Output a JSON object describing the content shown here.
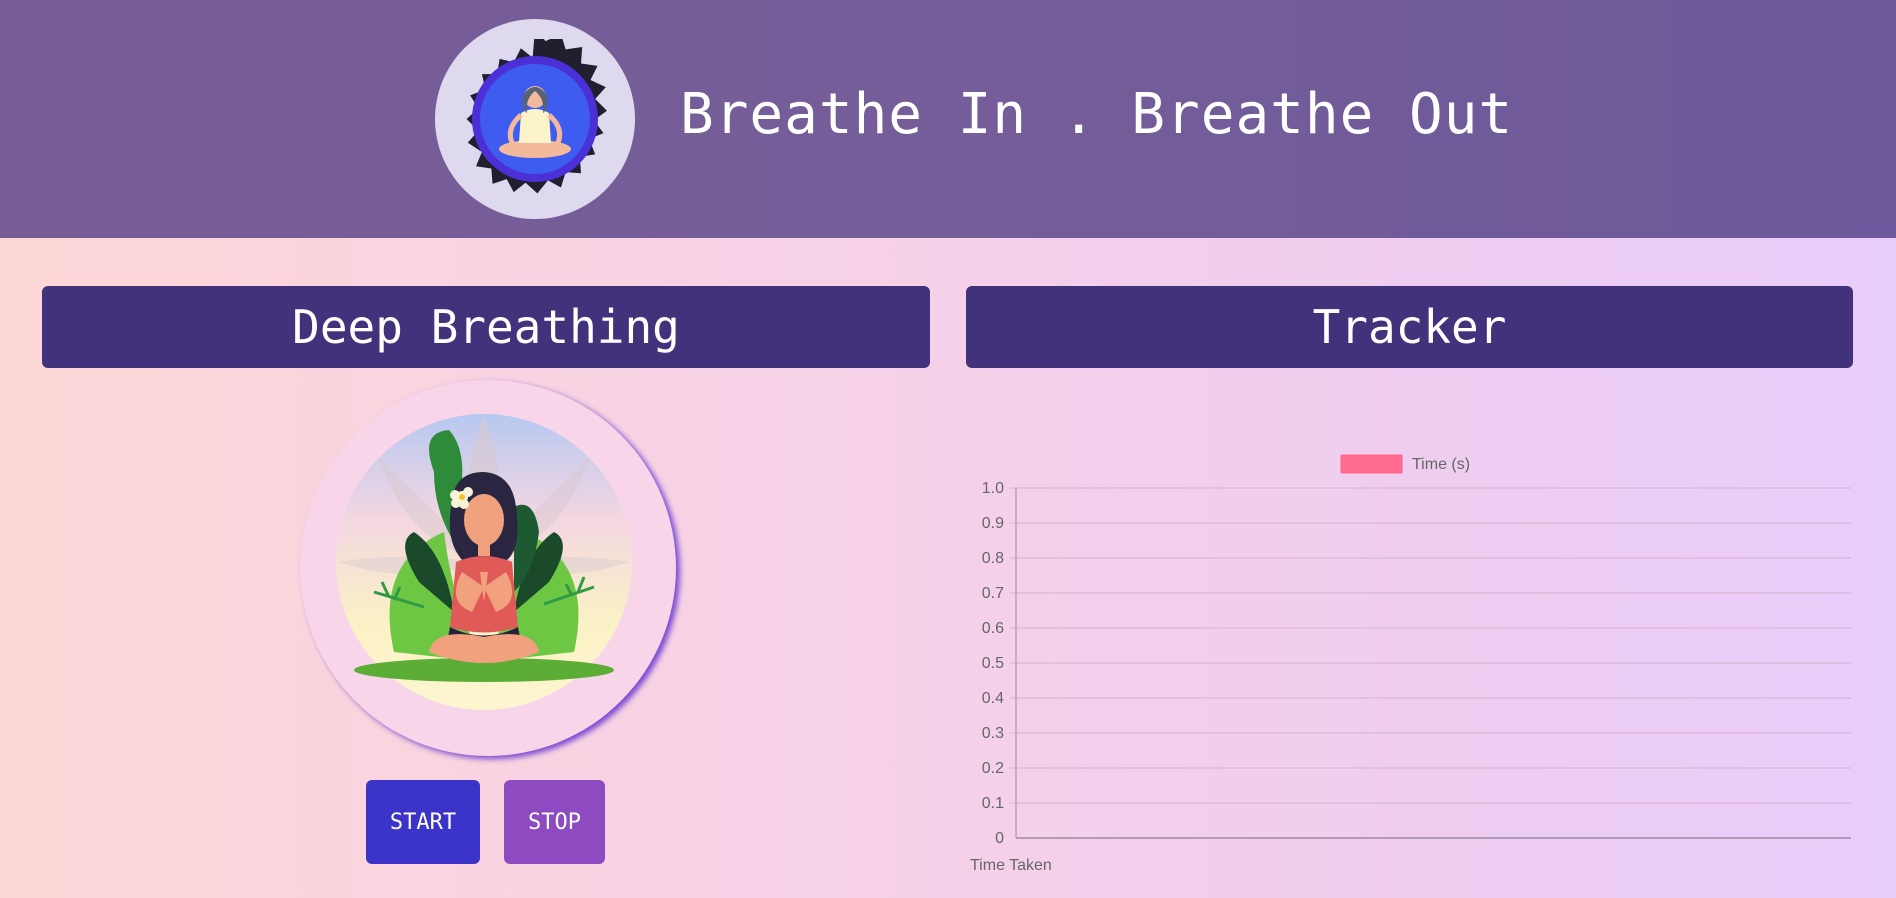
{
  "header": {
    "title": "Breathe In . Breathe Out",
    "logo_icon": "meditation-logo-icon"
  },
  "left_panel": {
    "title": "Deep Breathing",
    "illustration_icon": "meditating-woman-illustration",
    "start_label": "START",
    "stop_label": "STOP"
  },
  "right_panel": {
    "title": "Tracker"
  },
  "colors": {
    "header_bg": "#745d98",
    "panel_title_bg": "#42327b",
    "start_button": "#3c34c8",
    "stop_button": "#8e4bc1",
    "series_fill": "#ff6384"
  },
  "chart_data": {
    "type": "bar",
    "categories": [],
    "series": [
      {
        "name": "Time (s)",
        "values": []
      }
    ],
    "xlabel": "Time Taken",
    "ylabel": "",
    "ylim": [
      0,
      1
    ],
    "yticks": [
      "0",
      "0.1",
      "0.2",
      "0.3",
      "0.4",
      "0.5",
      "0.6",
      "0.7",
      "0.8",
      "0.9",
      "1.0"
    ],
    "grid": true,
    "legend": "top-center"
  }
}
